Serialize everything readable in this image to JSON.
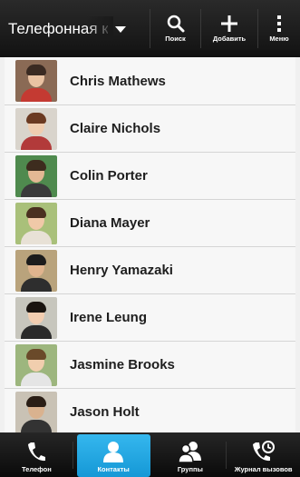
{
  "topbar": {
    "title": "Телефонная книга",
    "actions": [
      {
        "label": "Поиск",
        "icon": "search-icon"
      },
      {
        "label": "Добавить",
        "icon": "plus-icon"
      },
      {
        "label": "Меню",
        "icon": "kebab-menu-icon"
      }
    ]
  },
  "contacts": [
    {
      "name": "Chris Mathews",
      "photo_colors": {
        "bg": "#8a6a55",
        "skin": "#e9c2a2",
        "shirt": "#c43a32",
        "hair": "#3a2a22"
      }
    },
    {
      "name": "Claire Nichols",
      "photo_colors": {
        "bg": "#d9d4cc",
        "skin": "#f0cdb0",
        "shirt": "#b23a3a",
        "hair": "#6b3a22"
      }
    },
    {
      "name": "Colin Porter",
      "photo_colors": {
        "bg": "#4f8a4e",
        "skin": "#e3b894",
        "shirt": "#3a3a3a",
        "hair": "#3d2c1e"
      }
    },
    {
      "name": "Diana Mayer",
      "photo_colors": {
        "bg": "#a9c07a",
        "skin": "#f0c9a8",
        "shirt": "#e8e1d6",
        "hair": "#4a3020"
      }
    },
    {
      "name": "Henry Yamazaki",
      "photo_colors": {
        "bg": "#b9a37c",
        "skin": "#e0b48e",
        "shirt": "#2e2e2e",
        "hair": "#1c1c1c"
      }
    },
    {
      "name": "Irene Leung",
      "photo_colors": {
        "bg": "#c7c6bd",
        "skin": "#f2cdb0",
        "shirt": "#2a2a2a",
        "hair": "#1a1410"
      }
    },
    {
      "name": "Jasmine Brooks",
      "photo_colors": {
        "bg": "#9db67e",
        "skin": "#f1ceae",
        "shirt": "#e5e5e5",
        "hair": "#6a4a2a"
      }
    },
    {
      "name": "Jason Holt",
      "photo_colors": {
        "bg": "#c9c2b5",
        "skin": "#d9b28f",
        "shirt": "#333333",
        "hair": "#2a1e16"
      }
    }
  ],
  "tabs": [
    {
      "label": "Телефон",
      "icon": "phone-icon",
      "active": false
    },
    {
      "label": "Контакты",
      "icon": "person-icon",
      "active": true
    },
    {
      "label": "Группы",
      "icon": "group-icon",
      "active": false
    },
    {
      "label": "Журнал вызовов",
      "icon": "call-history-icon",
      "active": false
    }
  ],
  "colors": {
    "accent": "#1fa6e2",
    "bar": "#1a1a1a",
    "list_bg": "#f7f7f7",
    "divider": "#d5d5d5"
  }
}
